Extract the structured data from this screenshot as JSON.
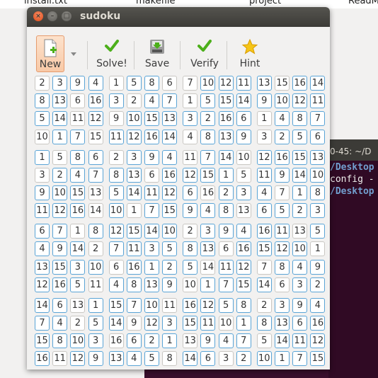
{
  "desktop": {
    "files": [
      "install.txt",
      "makefile",
      "project",
      "ReadM"
    ]
  },
  "terminal": {
    "title": "0-45: ~/D",
    "lines": [
      "/Desktop",
      "config -",
      "/Desktop"
    ]
  },
  "window": {
    "title": "sudoku",
    "close_glyph": "×",
    "min_glyph": "–",
    "max_glyph": "□"
  },
  "toolbar": {
    "new_label": "New",
    "solve_label": "Solve!",
    "save_label": "Save",
    "verify_label": "Verify",
    "hint_label": "Hint"
  },
  "colors": {
    "cell_border_active": "#5aa4d6",
    "cell_border_empty": "#c9c7c3",
    "new_button_bg": "#f8c9a7",
    "check_green": "#4caf1a",
    "hint_star": "#f5c518"
  },
  "grid": [
    [
      "2",
      "3",
      "9",
      "4",
      "1",
      "5",
      "8",
      "6",
      "7",
      "10",
      "12",
      "11",
      "13",
      "15",
      "16",
      "14"
    ],
    [
      "8",
      "13",
      "6",
      "16",
      "3",
      "2",
      "4",
      "7",
      "1",
      "5",
      "15",
      "14",
      "9",
      "10",
      "12",
      "11"
    ],
    [
      "5",
      "14",
      "11",
      "12",
      "9",
      "10",
      "15",
      "13",
      "3",
      "2",
      "16",
      "6",
      "1",
      "4",
      "8",
      "7"
    ],
    [
      "10",
      "1",
      "7",
      "15",
      "11",
      "12",
      "16",
      "14",
      "4",
      "8",
      "13",
      "9",
      "3",
      "2",
      "5",
      "6"
    ],
    [
      "1",
      "5",
      "8",
      "6",
      "2",
      "3",
      "9",
      "4",
      "11",
      "7",
      "14",
      "10",
      "12",
      "16",
      "15",
      "13"
    ],
    [
      "3",
      "2",
      "4",
      "7",
      "8",
      "13",
      "6",
      "16",
      "12",
      "15",
      "1",
      "5",
      "11",
      "9",
      "14",
      "10"
    ],
    [
      "9",
      "10",
      "15",
      "13",
      "5",
      "14",
      "11",
      "12",
      "6",
      "16",
      "2",
      "3",
      "4",
      "7",
      "1",
      "8"
    ],
    [
      "11",
      "12",
      "16",
      "14",
      "10",
      "1",
      "7",
      "15",
      "9",
      "4",
      "8",
      "13",
      "6",
      "5",
      "2",
      "3"
    ],
    [
      "6",
      "7",
      "1",
      "8",
      "12",
      "15",
      "14",
      "10",
      "2",
      "3",
      "9",
      "4",
      "16",
      "11",
      "13",
      "5"
    ],
    [
      "4",
      "9",
      "14",
      "2",
      "7",
      "11",
      "3",
      "5",
      "8",
      "13",
      "6",
      "16",
      "15",
      "12",
      "10",
      "1"
    ],
    [
      "13",
      "15",
      "3",
      "10",
      "6",
      "16",
      "1",
      "2",
      "5",
      "14",
      "11",
      "12",
      "7",
      "8",
      "4",
      "9"
    ],
    [
      "12",
      "16",
      "5",
      "11",
      "4",
      "8",
      "13",
      "9",
      "10",
      "1",
      "7",
      "15",
      "14",
      "6",
      "3",
      "2"
    ],
    [
      "14",
      "6",
      "13",
      "1",
      "15",
      "7",
      "10",
      "11",
      "16",
      "12",
      "5",
      "8",
      "2",
      "3",
      "9",
      "4"
    ],
    [
      "7",
      "4",
      "2",
      "5",
      "14",
      "9",
      "12",
      "3",
      "15",
      "11",
      "10",
      "1",
      "8",
      "13",
      "6",
      "16"
    ],
    [
      "15",
      "8",
      "10",
      "3",
      "16",
      "6",
      "2",
      "1",
      "13",
      "9",
      "4",
      "7",
      "5",
      "14",
      "11",
      "12"
    ],
    [
      "16",
      "11",
      "12",
      "9",
      "13",
      "4",
      "5",
      "8",
      "14",
      "6",
      "3",
      "2",
      "10",
      "1",
      "7",
      "15"
    ]
  ],
  "empty_cells": [
    [
      0,
      0
    ],
    [
      0,
      4
    ],
    [
      0,
      7
    ],
    [
      0,
      8
    ],
    [
      0,
      13
    ],
    [
      1,
      2
    ],
    [
      1,
      5
    ],
    [
      1,
      8
    ],
    [
      2,
      2
    ],
    [
      2,
      4
    ],
    [
      2,
      12
    ],
    [
      3,
      0
    ],
    [
      3,
      3
    ],
    [
      3,
      8
    ],
    [
      3,
      12
    ],
    [
      4,
      1
    ],
    [
      4,
      4
    ],
    [
      4,
      8
    ],
    [
      4,
      11
    ],
    [
      5,
      0
    ],
    [
      5,
      6
    ],
    [
      5,
      11
    ],
    [
      6,
      3
    ],
    [
      6,
      9
    ],
    [
      6,
      13
    ],
    [
      7,
      3
    ],
    [
      7,
      5
    ],
    [
      7,
      11
    ],
    [
      8,
      2
    ],
    [
      8,
      8
    ],
    [
      8,
      14
    ],
    [
      9,
      3
    ],
    [
      9,
      10
    ],
    [
      9,
      15
    ],
    [
      10,
      4
    ],
    [
      10,
      9
    ],
    [
      10,
      12
    ],
    [
      11,
      3
    ],
    [
      11,
      8
    ],
    [
      11,
      13
    ],
    [
      12,
      2
    ],
    [
      12,
      7
    ],
    [
      12,
      12
    ],
    [
      13,
      2
    ],
    [
      13,
      5
    ],
    [
      13,
      10
    ],
    [
      14,
      4
    ],
    [
      14,
      8
    ],
    [
      14,
      12
    ],
    [
      15,
      1
    ],
    [
      15,
      7
    ],
    [
      15,
      10
    ]
  ]
}
